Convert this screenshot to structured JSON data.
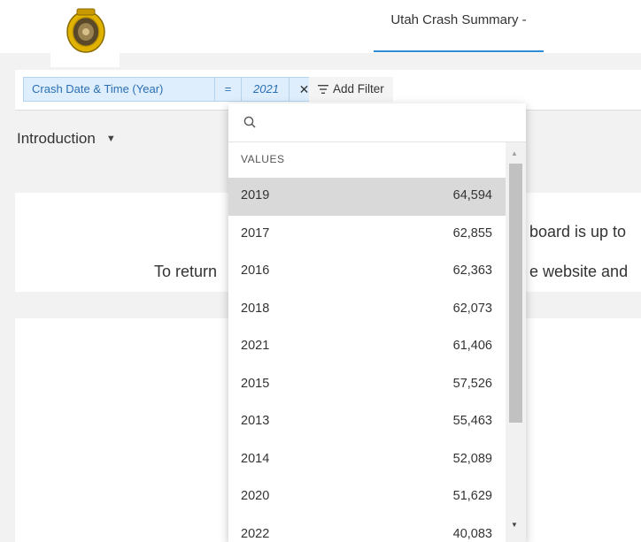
{
  "header": {
    "logo_icon": "utah-highway-patrol-badge-icon",
    "nav_tab_label": "Utah Crash Summary -",
    "accent_color": "#2e8bd6"
  },
  "filter": {
    "field_label": "Crash Date & Time (Year)",
    "operator": "=",
    "value": "2021",
    "remove_icon": "close-icon",
    "add_filter_label": "Add Filter",
    "add_filter_icon": "filter-lines-icon"
  },
  "page_select": {
    "label": "Introduction",
    "icon": "caret-down-icon"
  },
  "background_text": {
    "line1_fragment": "board is up to",
    "line2_left": "To return",
    "line2_right": "e website and"
  },
  "dropdown": {
    "search_icon": "search-icon",
    "search_value": "",
    "section_label": "VALUES",
    "items": [
      {
        "year": "2019",
        "count": "64,594",
        "highlighted": true
      },
      {
        "year": "2017",
        "count": "62,855"
      },
      {
        "year": "2016",
        "count": "62,363"
      },
      {
        "year": "2018",
        "count": "62,073"
      },
      {
        "year": "2021",
        "count": "61,406"
      },
      {
        "year": "2015",
        "count": "57,526"
      },
      {
        "year": "2013",
        "count": "55,463"
      },
      {
        "year": "2014",
        "count": "52,089"
      },
      {
        "year": "2020",
        "count": "51,629"
      },
      {
        "year": "2022",
        "count": "40,083"
      }
    ],
    "scroll_up_icon": "scroll-up-arrow-icon",
    "scroll_down_icon": "scroll-down-arrow-icon"
  }
}
